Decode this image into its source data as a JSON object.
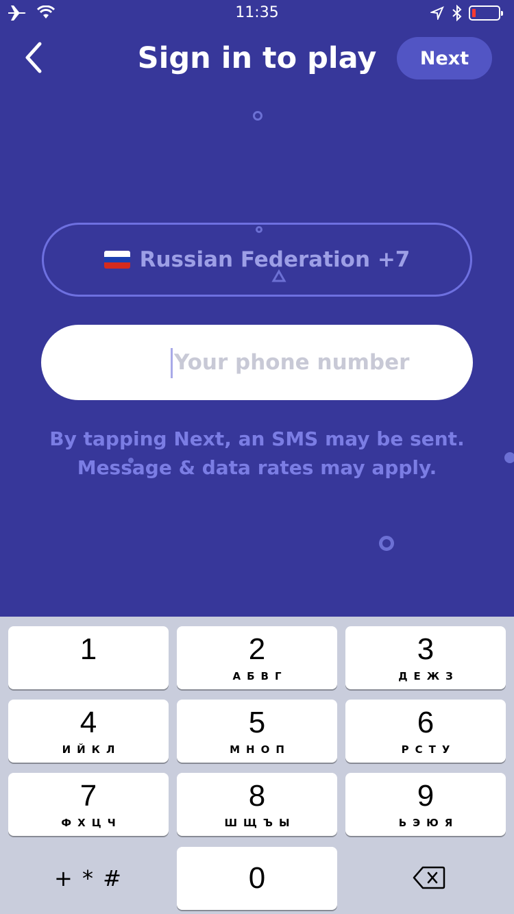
{
  "status": {
    "time": "11:35"
  },
  "header": {
    "title": "Sign in to play",
    "next_label": "Next"
  },
  "country": {
    "label": "Russian Federation +7",
    "flag": "russian-flag"
  },
  "phone": {
    "placeholder": "Your phone number"
  },
  "notice": {
    "line1": "By tapping Next, an SMS may be sent.",
    "line2": "Message & data rates may apply."
  },
  "keypad": {
    "keys": [
      {
        "num": "1",
        "letters": ""
      },
      {
        "num": "2",
        "letters": "АБВГ"
      },
      {
        "num": "3",
        "letters": "ДЕЖЗ"
      },
      {
        "num": "4",
        "letters": "ИЙКЛ"
      },
      {
        "num": "5",
        "letters": "МНОП"
      },
      {
        "num": "6",
        "letters": "РСТУ"
      },
      {
        "num": "7",
        "letters": "ФХЦЧ"
      },
      {
        "num": "8",
        "letters": "ШЩЪЫ"
      },
      {
        "num": "9",
        "letters": "ЬЭЮЯ"
      },
      {
        "num": "0",
        "letters": ""
      }
    ],
    "symbols": "+ * #"
  },
  "colors": {
    "background": "#37379a",
    "accent": "#5255c4",
    "outline": "#6e70e0"
  }
}
